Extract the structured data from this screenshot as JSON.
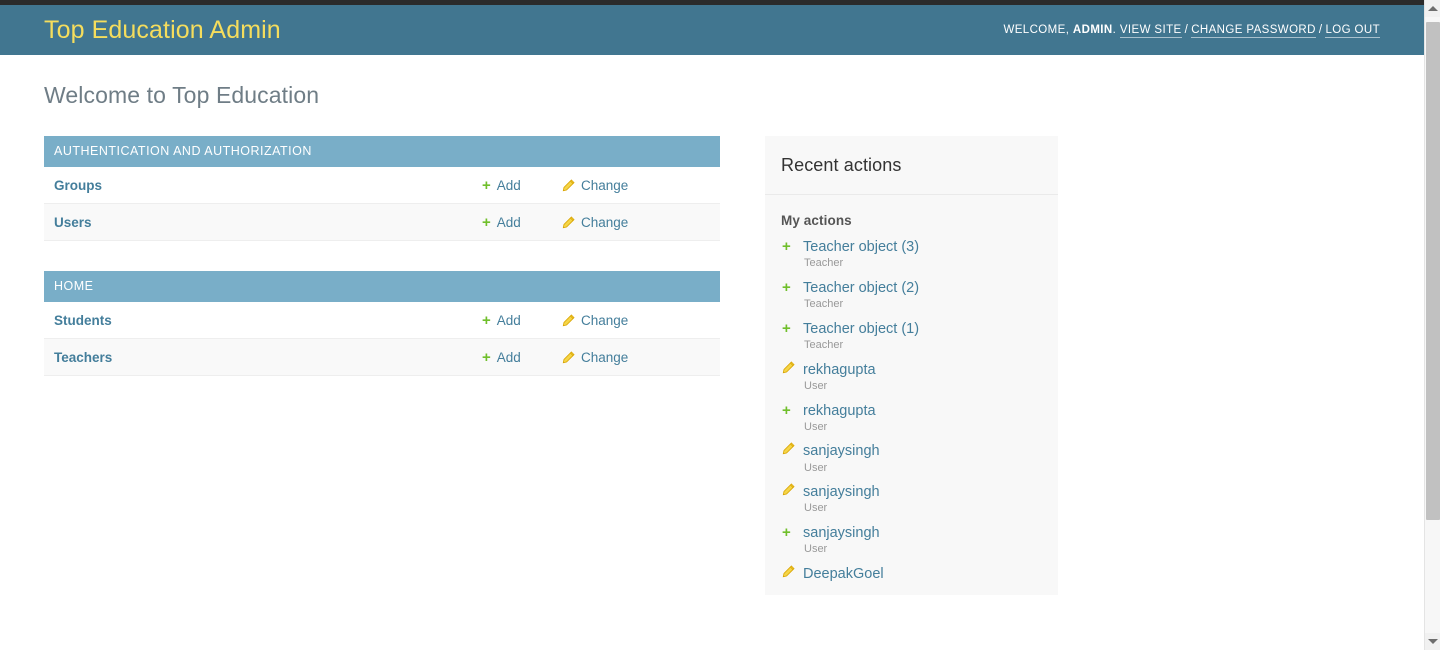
{
  "header": {
    "branding": "Top Education Admin",
    "welcome_prefix": "WELCOME,",
    "username": "ADMIN",
    "period": ".",
    "view_site": "VIEW SITE",
    "separator": "/",
    "change_password": "CHANGE PASSWORD",
    "log_out": "LOG OUT"
  },
  "page": {
    "title": "Welcome to Top Education"
  },
  "colors": {
    "header_bg": "#417690",
    "branding_text": "#f5dd5d",
    "module_caption_bg": "#79aec8",
    "link": "#447e9b",
    "add_icon": "#70bf2b",
    "change_icon": "#efb80b",
    "sidebar_bg": "#f8f8f8"
  },
  "modules": [
    {
      "caption": "AUTHENTICATION AND AUTHORIZATION",
      "rows": [
        {
          "name": "Groups",
          "add_label": "Add",
          "change_label": "Change"
        },
        {
          "name": "Users",
          "add_label": "Add",
          "change_label": "Change"
        }
      ]
    },
    {
      "caption": "HOME",
      "rows": [
        {
          "name": "Students",
          "add_label": "Add",
          "change_label": "Change"
        },
        {
          "name": "Teachers",
          "add_label": "Add",
          "change_label": "Change"
        }
      ]
    }
  ],
  "sidebar": {
    "title": "Recent actions",
    "subtitle": "My actions",
    "actions": [
      {
        "type": "add",
        "label": "Teacher object (3)",
        "content_type": "Teacher"
      },
      {
        "type": "add",
        "label": "Teacher object (2)",
        "content_type": "Teacher"
      },
      {
        "type": "add",
        "label": "Teacher object (1)",
        "content_type": "Teacher"
      },
      {
        "type": "change",
        "label": "rekhagupta",
        "content_type": "User"
      },
      {
        "type": "add",
        "label": "rekhagupta",
        "content_type": "User"
      },
      {
        "type": "change",
        "label": "sanjaysingh",
        "content_type": "User"
      },
      {
        "type": "change",
        "label": "sanjaysingh",
        "content_type": "User"
      },
      {
        "type": "add",
        "label": "sanjaysingh",
        "content_type": "User"
      },
      {
        "type": "change",
        "label": "DeepakGoel",
        "content_type": ""
      }
    ]
  },
  "icons": {
    "add": "+",
    "scroll_up": "▲",
    "scroll_down": "▼"
  }
}
